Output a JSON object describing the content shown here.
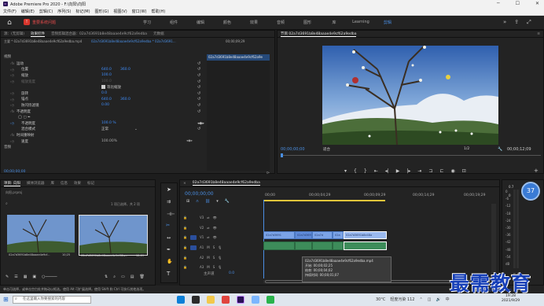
{
  "window": {
    "app": "Pr",
    "title": "Adobe Premiere Pro 2020 - F:\\向阳\\向阳"
  },
  "menu": [
    "文件(F)",
    "编辑(E)",
    "剪辑(C)",
    "序列(S)",
    "标记(M)",
    "图形(G)",
    "视图(V)",
    "窗口(W)",
    "帮助(H)"
  ],
  "topbar": {
    "warning": "重要系统问题",
    "workspaces": [
      "学习",
      "组件",
      "编辑",
      "颜色",
      "效果",
      "音频",
      "图形",
      "库",
      "Learning",
      "剪辑"
    ],
    "active_workspace": "剪辑"
  },
  "effect_controls": {
    "tabs": [
      "源：(无剪辑)",
      "效果控件",
      "音频剪辑混合器：02a7d3691b8e48aaae4e9cf62a9edba",
      "元数据"
    ],
    "active_tab": "效果控件",
    "master_clip": "主要 * 02a7d3691b8e48aaae4e9cf62a9edba.mp4",
    "sequence_clip": "02a7d3691b8e48aaae4e9cf62a9edba * 02a7d3691...",
    "timecode_right": "00;00;09;29",
    "clip_chip": "02a7d3691b8e48aaae4e9cf62a9e",
    "video_header": "视频",
    "rows": [
      {
        "label": "运动",
        "type": "section"
      },
      {
        "label": "位置",
        "v1": "640.0",
        "v2": "360.0"
      },
      {
        "label": "缩放",
        "v1": "100.0"
      },
      {
        "label": "缩放宽度",
        "v1": "100.0"
      },
      {
        "label": "等比缩放",
        "type": "checkbox"
      },
      {
        "label": "旋转",
        "v1": "0.0"
      },
      {
        "label": "锚点",
        "v1": "640.0",
        "v2": "360.0"
      },
      {
        "label": "防闪烁滤镜",
        "v1": "0.00"
      },
      {
        "label": "不透明度",
        "type": "section"
      },
      {
        "label": "",
        "type": "masks"
      },
      {
        "label": "不透明度",
        "v1": "100.0 %"
      },
      {
        "label": "混合模式",
        "v1": "正常"
      },
      {
        "label": "时间重映射",
        "type": "section"
      },
      {
        "label": "速度",
        "v1": "100.00%"
      }
    ],
    "audio_header": "音频",
    "bottom_timecode": "00;00;00;00"
  },
  "program": {
    "title": "节目 02a7d3691b8e48aaae4e9cf62a9edba",
    "timecode": "00;00;00;00",
    "fit": "适合",
    "fraction": "1/2",
    "duration": "00;00;12;09"
  },
  "project": {
    "tabs": [
      "项目: 向阳",
      "媒体浏览器",
      "库",
      "信息",
      "效果",
      "标记"
    ],
    "file": "向阳.prproj",
    "selection": "1 项已选择，共 2 项",
    "items": [
      {
        "name": "02a7d3691b8e48aaae4e9cf...",
        "duration": "10;25"
      },
      {
        "name": "02a7d3691b8e48aaae4e9cf62a...",
        "duration": "12;09"
      }
    ]
  },
  "timeline": {
    "title": "02a7d3691b8e48aaae4e9cf62a9edba",
    "timecode": "00;00;00;00",
    "ruler": [
      "00;00",
      "00;00;04;29",
      "00;00;09;29",
      "00;00;14;29",
      "00;00;19;29"
    ],
    "video_tracks": [
      "V3",
      "V2",
      "V1"
    ],
    "audio_tracks": [
      "A1",
      "A2",
      "A3"
    ],
    "master": "主声道",
    "master_val": "0.0",
    "clips": [
      "02a7d3691",
      "02a7d",
      "02a",
      "02a7d3691b8e48a"
    ],
    "tooltip": {
      "name": "02a7d3691b8e48aaae4e9cf62a9edba.mp4",
      "start": "开始: 00;00;02;25",
      "end": "结束: 00;00;04;02",
      "duration": "持续时间: 00;00;01;07"
    }
  },
  "meter": {
    "scale": [
      "0",
      "-6",
      "-12",
      "-18",
      "-24",
      "-30",
      "-36",
      "-42",
      "-48",
      "-54",
      "dB"
    ],
    "cpu": "37",
    "up": "0.7",
    "down": "0"
  },
  "status_bar": "单击可选择，或单击空白处并拖动以框选。使用 Alt 可扩展选择。使用 Shift 和 Ctrl 可执行其他选项。",
  "taskbar": {
    "search": "在这里输入你要搜索的内容",
    "temp": "30°C",
    "air": "轻度污染 112",
    "ime": "中",
    "time": "19:28",
    "date": "2021/9/29"
  },
  "watermark": {
    "text": "最需教育",
    "sub": "zuixujiaoyu.com"
  }
}
